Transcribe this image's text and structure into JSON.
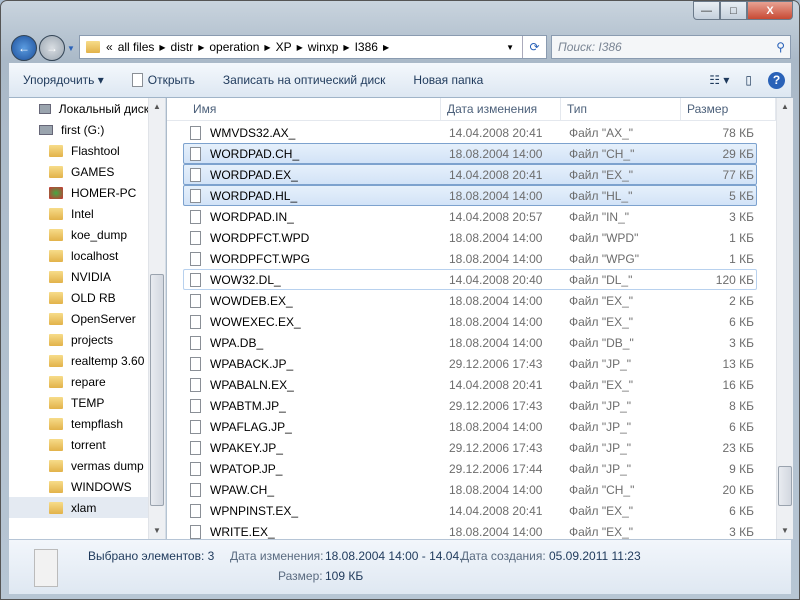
{
  "window": {
    "min": "—",
    "max": "□",
    "close": "X"
  },
  "address": {
    "crumbs": [
      "all files",
      "distr",
      "operation",
      "XP",
      "winxp",
      "I386"
    ],
    "overflow": "«"
  },
  "search": {
    "placeholder": "Поиск: I386"
  },
  "toolbar": {
    "organize": "Упорядочить ▾",
    "open": "Открыть",
    "burn": "Записать на оптический диск",
    "new_folder": "Новая папка",
    "help": "?"
  },
  "sidebar": {
    "items": [
      {
        "label": "Локальный диск",
        "icon": "drive-icon"
      },
      {
        "label": "first (G:)",
        "icon": "drive-icon"
      },
      {
        "label": "Flashtool"
      },
      {
        "label": "GAMES"
      },
      {
        "label": "HOMER-PC",
        "icon": "network-folder-icon"
      },
      {
        "label": "Intel"
      },
      {
        "label": "koe_dump"
      },
      {
        "label": "localhost"
      },
      {
        "label": "NVIDIA"
      },
      {
        "label": "OLD RB"
      },
      {
        "label": "OpenServer"
      },
      {
        "label": "projects"
      },
      {
        "label": "realtemp 3.60"
      },
      {
        "label": "repare"
      },
      {
        "label": "TEMP"
      },
      {
        "label": "tempflash"
      },
      {
        "label": "torrent"
      },
      {
        "label": "vermas dump"
      },
      {
        "label": "WINDOWS"
      },
      {
        "label": "xlam",
        "selected": true
      }
    ]
  },
  "columns": {
    "name": "Имя",
    "date": "Дата изменения",
    "type": "Тип",
    "size": "Размер"
  },
  "files": [
    {
      "name": "WMVDS32.AX_",
      "date": "14.04.2008 20:41",
      "type": "Файл \"AX_\"",
      "size": "78 КБ"
    },
    {
      "name": "WORDPAD.CH_",
      "date": "18.08.2004 14:00",
      "type": "Файл \"CH_\"",
      "size": "29 КБ",
      "selected": true
    },
    {
      "name": "WORDPAD.EX_",
      "date": "14.04.2008 20:41",
      "type": "Файл \"EX_\"",
      "size": "77 КБ",
      "selected": true
    },
    {
      "name": "WORDPAD.HL_",
      "date": "18.08.2004 14:00",
      "type": "Файл \"HL_\"",
      "size": "5 КБ",
      "selected": true
    },
    {
      "name": "WORDPAD.IN_",
      "date": "14.04.2008 20:57",
      "type": "Файл \"IN_\"",
      "size": "3 КБ"
    },
    {
      "name": "WORDPFCT.WPD",
      "date": "18.08.2004 14:00",
      "type": "Файл \"WPD\"",
      "size": "1 КБ"
    },
    {
      "name": "WORDPFCT.WPG",
      "date": "18.08.2004 14:00",
      "type": "Файл \"WPG\"",
      "size": "1 КБ"
    },
    {
      "name": "WOW32.DL_",
      "date": "14.04.2008 20:40",
      "type": "Файл \"DL_\"",
      "size": "120 КБ",
      "hover": true
    },
    {
      "name": "WOWDEB.EX_",
      "date": "18.08.2004 14:00",
      "type": "Файл \"EX_\"",
      "size": "2 КБ"
    },
    {
      "name": "WOWEXEC.EX_",
      "date": "18.08.2004 14:00",
      "type": "Файл \"EX_\"",
      "size": "6 КБ"
    },
    {
      "name": "WPA.DB_",
      "date": "18.08.2004 14:00",
      "type": "Файл \"DB_\"",
      "size": "3 КБ"
    },
    {
      "name": "WPABACK.JP_",
      "date": "29.12.2006 17:43",
      "type": "Файл \"JP_\"",
      "size": "13 КБ"
    },
    {
      "name": "WPABALN.EX_",
      "date": "14.04.2008 20:41",
      "type": "Файл \"EX_\"",
      "size": "16 КБ"
    },
    {
      "name": "WPABTM.JP_",
      "date": "29.12.2006 17:43",
      "type": "Файл \"JP_\"",
      "size": "8 КБ"
    },
    {
      "name": "WPAFLAG.JP_",
      "date": "18.08.2004 14:00",
      "type": "Файл \"JP_\"",
      "size": "6 КБ"
    },
    {
      "name": "WPAKEY.JP_",
      "date": "29.12.2006 17:43",
      "type": "Файл \"JP_\"",
      "size": "23 КБ"
    },
    {
      "name": "WPATOP.JP_",
      "date": "29.12.2006 17:44",
      "type": "Файл \"JP_\"",
      "size": "9 КБ"
    },
    {
      "name": "WPAW.CH_",
      "date": "18.08.2004 14:00",
      "type": "Файл \"CH_\"",
      "size": "20 КБ"
    },
    {
      "name": "WPNPINST.EX_",
      "date": "14.04.2008 20:41",
      "type": "Файл \"EX_\"",
      "size": "6 КБ"
    },
    {
      "name": "WRITE.EX_",
      "date": "18.08.2004 14:00",
      "type": "Файл \"EX_\"",
      "size": "3 КБ"
    }
  ],
  "status": {
    "selected": "Выбрано элементов: 3",
    "modified_label": "Дата изменения:",
    "modified": "18.08.2004 14:00 - 14.04....",
    "created_label": "Дата создания:",
    "created": "05.09.2011 11:23",
    "size_label": "Размер:",
    "size": "109 КБ"
  }
}
